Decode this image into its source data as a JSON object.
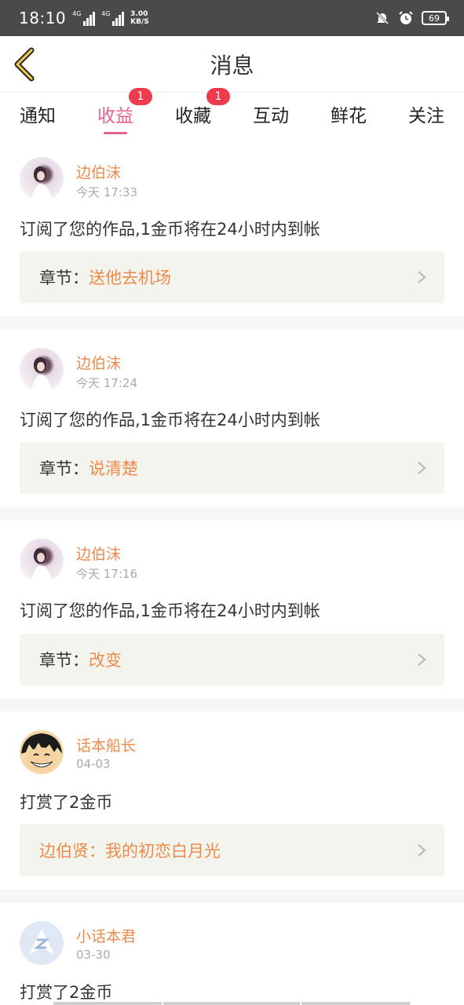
{
  "status_bar": {
    "time": "18:10",
    "net1": "4G",
    "net2": "4G",
    "speed_value": "3.00",
    "speed_unit": "KB/S",
    "battery": "69"
  },
  "header": {
    "title": "消息"
  },
  "tabs": [
    {
      "label": "通知",
      "badge": ""
    },
    {
      "label": "收益",
      "badge": "1",
      "active": true
    },
    {
      "label": "收藏",
      "badge": "1"
    },
    {
      "label": "互动",
      "badge": ""
    },
    {
      "label": "鲜花",
      "badge": ""
    },
    {
      "label": "关注",
      "badge": ""
    }
  ],
  "feed": [
    {
      "user": "边伯沫",
      "time": "今天 17:33",
      "message": "订阅了您的作品,1金币将在24小时内到帐",
      "box_label": "章节：",
      "box_value": "送他去机场",
      "avatar": "girl-photo"
    },
    {
      "user": "边伯沫",
      "time": "今天 17:24",
      "message": "订阅了您的作品,1金币将在24小时内到帐",
      "box_label": "章节：",
      "box_value": "说清楚",
      "avatar": "girl-photo"
    },
    {
      "user": "边伯沫",
      "time": "今天 17:16",
      "message": "订阅了您的作品,1金币将在24小时内到帐",
      "box_label": "章节：",
      "box_value": "改变",
      "avatar": "girl-photo"
    },
    {
      "user": "话本船长",
      "time": "04-03",
      "message": "打赏了2金币",
      "box_label": "",
      "box_value": "边伯贤：我的初恋白月光",
      "avatar": "cartoon-face"
    },
    {
      "user": "小话本君",
      "time": "03-30",
      "message": "打赏了2金币",
      "box_label": "",
      "box_value": "",
      "avatar": "default-logo"
    }
  ],
  "colors": {
    "accent": "#e8618c",
    "orange": "#ec8a4a",
    "badge": "#ee3b4d"
  }
}
